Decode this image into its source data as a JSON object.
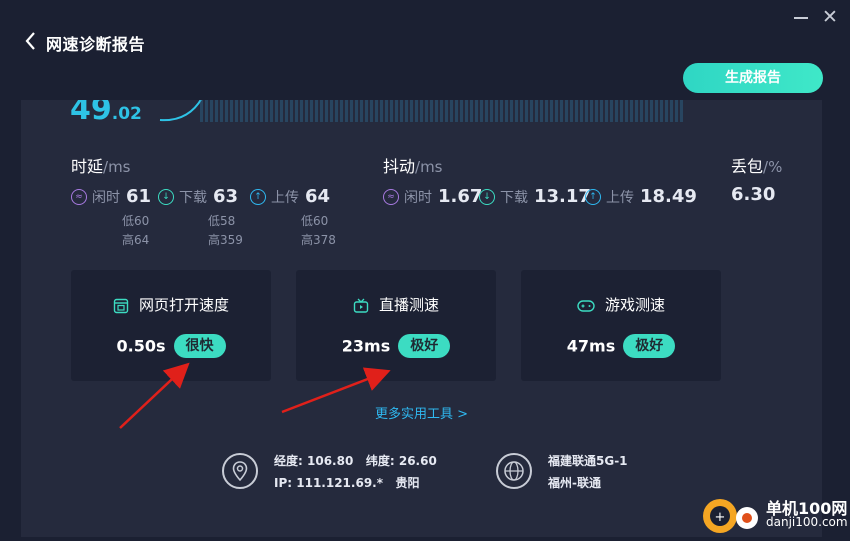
{
  "window": {
    "title": "网速诊断报告",
    "close_glyph": "✕"
  },
  "header": {
    "generate_button": "生成报告"
  },
  "speed": {
    "int_part": "49",
    "dec_part": ".02"
  },
  "latency": {
    "title": "时延",
    "unit": "/ms",
    "idle": {
      "label": "闲时",
      "value": "61"
    },
    "download": {
      "label": "下载",
      "value": "63",
      "low": "低58",
      "high": "高359"
    },
    "upload": {
      "label": "上传",
      "value": "64",
      "low": "低60",
      "high": "高378"
    },
    "idle_low": "低60",
    "idle_high": "高64"
  },
  "jitter": {
    "title": "抖动",
    "unit": "/ms",
    "idle": {
      "label": "闲时",
      "value": "1.67"
    },
    "download": {
      "label": "下载",
      "value": "13.17"
    },
    "upload": {
      "label": "上传",
      "value": "18.49"
    }
  },
  "packet_loss": {
    "title": "丢包",
    "unit": "/%",
    "value": "6.30"
  },
  "cards": [
    {
      "title": "网页打开速度",
      "value": "0.50s",
      "badge": "很快",
      "icon": "webpage-icon"
    },
    {
      "title": "直播测速",
      "value": "23ms",
      "badge": "极好",
      "icon": "tv-icon"
    },
    {
      "title": "游戏测速",
      "value": "47ms",
      "badge": "极好",
      "icon": "gamepad-icon"
    }
  ],
  "more_tools": "更多实用工具 >",
  "location": {
    "lon_label": "经度:",
    "lon": "106.80",
    "lat_label": "纬度:",
    "lat": "26.60",
    "ip_label": "IP:",
    "ip": "111.121.69.*",
    "city": "贵阳"
  },
  "network": {
    "isp_line1": "福建联通5G-1",
    "isp_line2": "福州-联通"
  },
  "watermark": {
    "line1": "单机100网",
    "line2": "danji100.com"
  },
  "colors": {
    "accent": "#3cdcc2",
    "link": "#2fb8f0",
    "speed": "#2ec3e6",
    "panel": "#252a3d",
    "card": "#1c2133",
    "arrow": "#e0201a"
  }
}
